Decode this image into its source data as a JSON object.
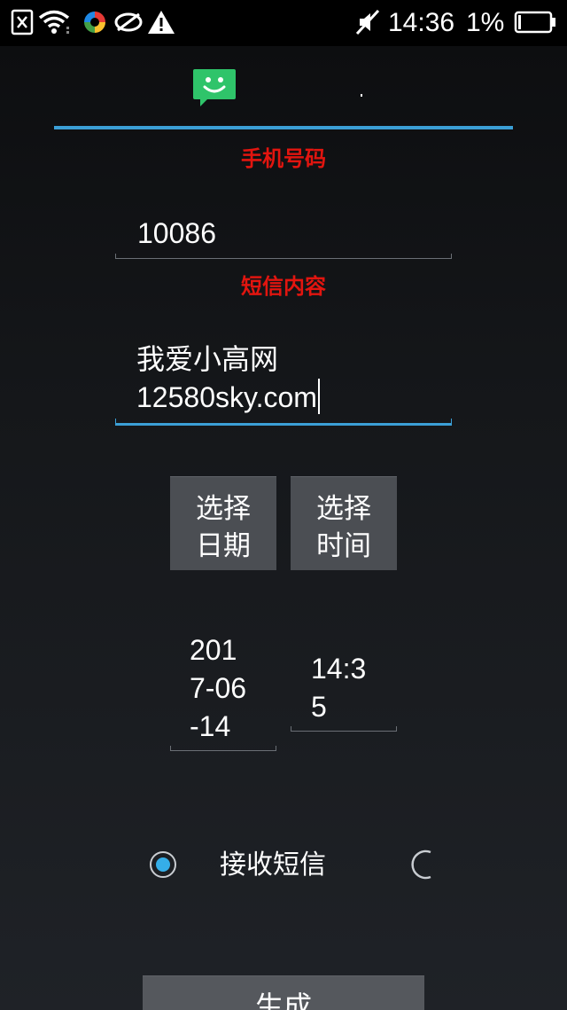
{
  "status_bar": {
    "time": "14:36",
    "battery_percent": "1%",
    "icons": [
      "sim-card-off-icon",
      "wifi-icon",
      "color-app-icon",
      "loop-app-icon",
      "warning-icon",
      "mute-icon",
      "battery-icon"
    ]
  },
  "header": {
    "app_icon": "chat-bubble-smile-icon",
    "accent_color": "#3b9fd6"
  },
  "form": {
    "phone_label": "手机号码",
    "phone_value": "10086",
    "content_label": "短信内容",
    "content_line1": "我爱小高网",
    "content_line2": "12580sky.com",
    "select_date_line1": "选择",
    "select_date_line2": "日期",
    "select_time_line1": "选择",
    "select_time_line2": "时间",
    "date_line1": "201",
    "date_line2": "7-06",
    "date_line3": "-14",
    "time_line1": "14:3",
    "time_line2": "5",
    "radio_receive_label": "接收短信",
    "radio_receive_checked": true,
    "generate_label": "生成"
  },
  "colors": {
    "label_red": "#e2150f",
    "radio_blue": "#35aee8",
    "button_gray": "#4b4e53"
  }
}
